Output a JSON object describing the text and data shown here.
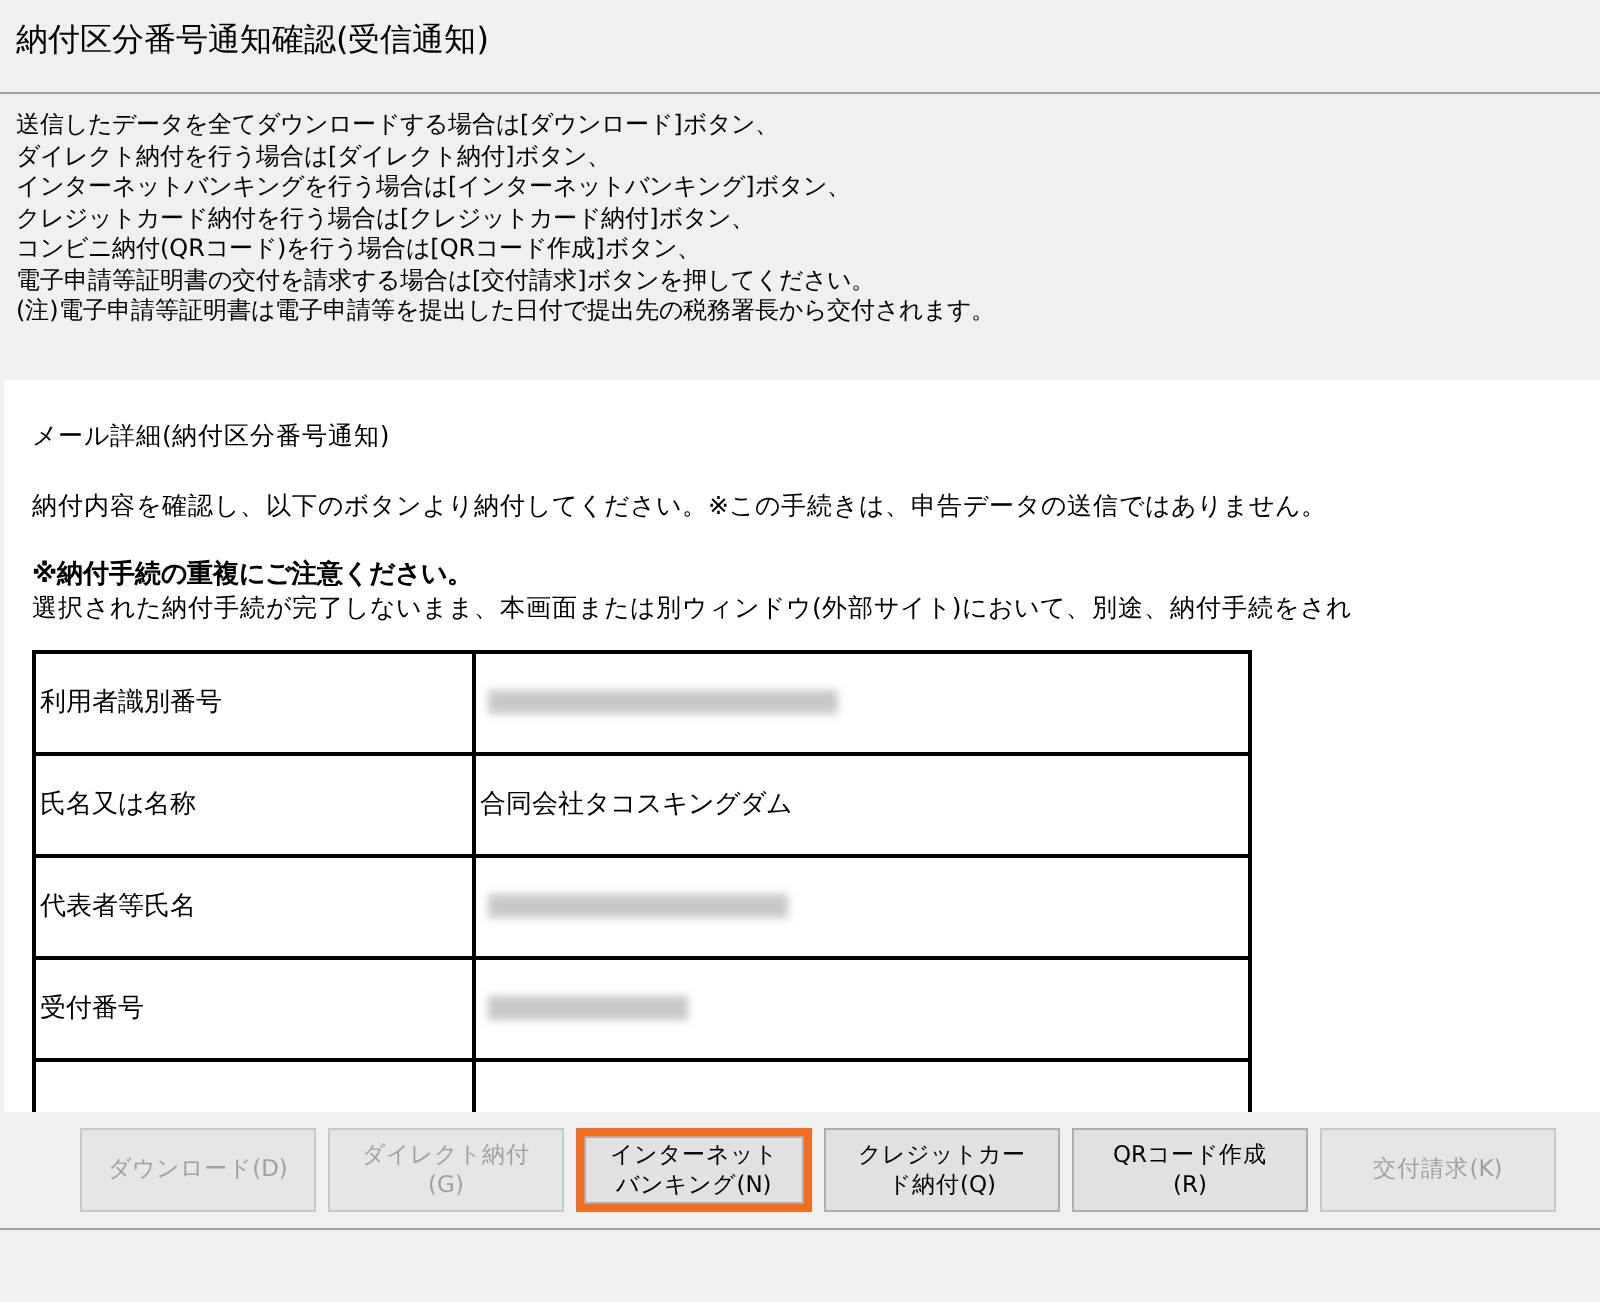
{
  "window": {
    "title": "納付区分番号通知確認(受信通知)"
  },
  "instructions": [
    "送信したデータを全てダウンロードする場合は[ダウンロード]ボタン、",
    "ダイレクト納付を行う場合は[ダイレクト納付]ボタン、",
    "インターネットバンキングを行う場合は[インターネットバンキング]ボタン、",
    "クレジットカード納付を行う場合は[クレジットカード納付]ボタン、",
    "コンビニ納付(QRコード)を行う場合は[QRコード作成]ボタン、",
    "電子申請等証明書の交付を請求する場合は[交付請求]ボタンを押してください。",
    "(注)電子申請等証明書は電子申請等を提出した日付で提出先の税務署長から交付されます。"
  ],
  "mail": {
    "heading": "メール詳細(納付区分番号通知)",
    "notice": "納付内容を確認し、以下のボタンより納付してください。※この手続きは、申告データの送信ではありません。",
    "warning_title": "※納付手続の重複にご注意ください。",
    "warning_text": "選択された納付手続が完了しないまま、本画面または別ウィンドウ(外部サイト)において、別途、納付手続をされ",
    "table": {
      "rows": [
        {
          "label": "利用者識別番号",
          "kind": "redacted"
        },
        {
          "label": "氏名又は名称",
          "kind": "text",
          "value": "合同会社タコスキングダム"
        },
        {
          "label": "代表者等氏名",
          "kind": "redacted"
        },
        {
          "label": "受付番号",
          "kind": "redacted"
        },
        {
          "kind": "cut"
        }
      ]
    }
  },
  "buttons": [
    {
      "label": "ダウンロード(D)",
      "disabled": true,
      "highlighted": false
    },
    {
      "label": "ダイレクト納付(G)",
      "disabled": true,
      "highlighted": false
    },
    {
      "label": "インターネットバンキング(N)",
      "disabled": false,
      "highlighted": true
    },
    {
      "label": "クレジットカード納付(Q)",
      "disabled": false,
      "highlighted": false
    },
    {
      "label": "QRコード作成(R)",
      "disabled": false,
      "highlighted": false
    },
    {
      "label": "交付請求(K)",
      "disabled": true,
      "highlighted": false
    }
  ]
}
